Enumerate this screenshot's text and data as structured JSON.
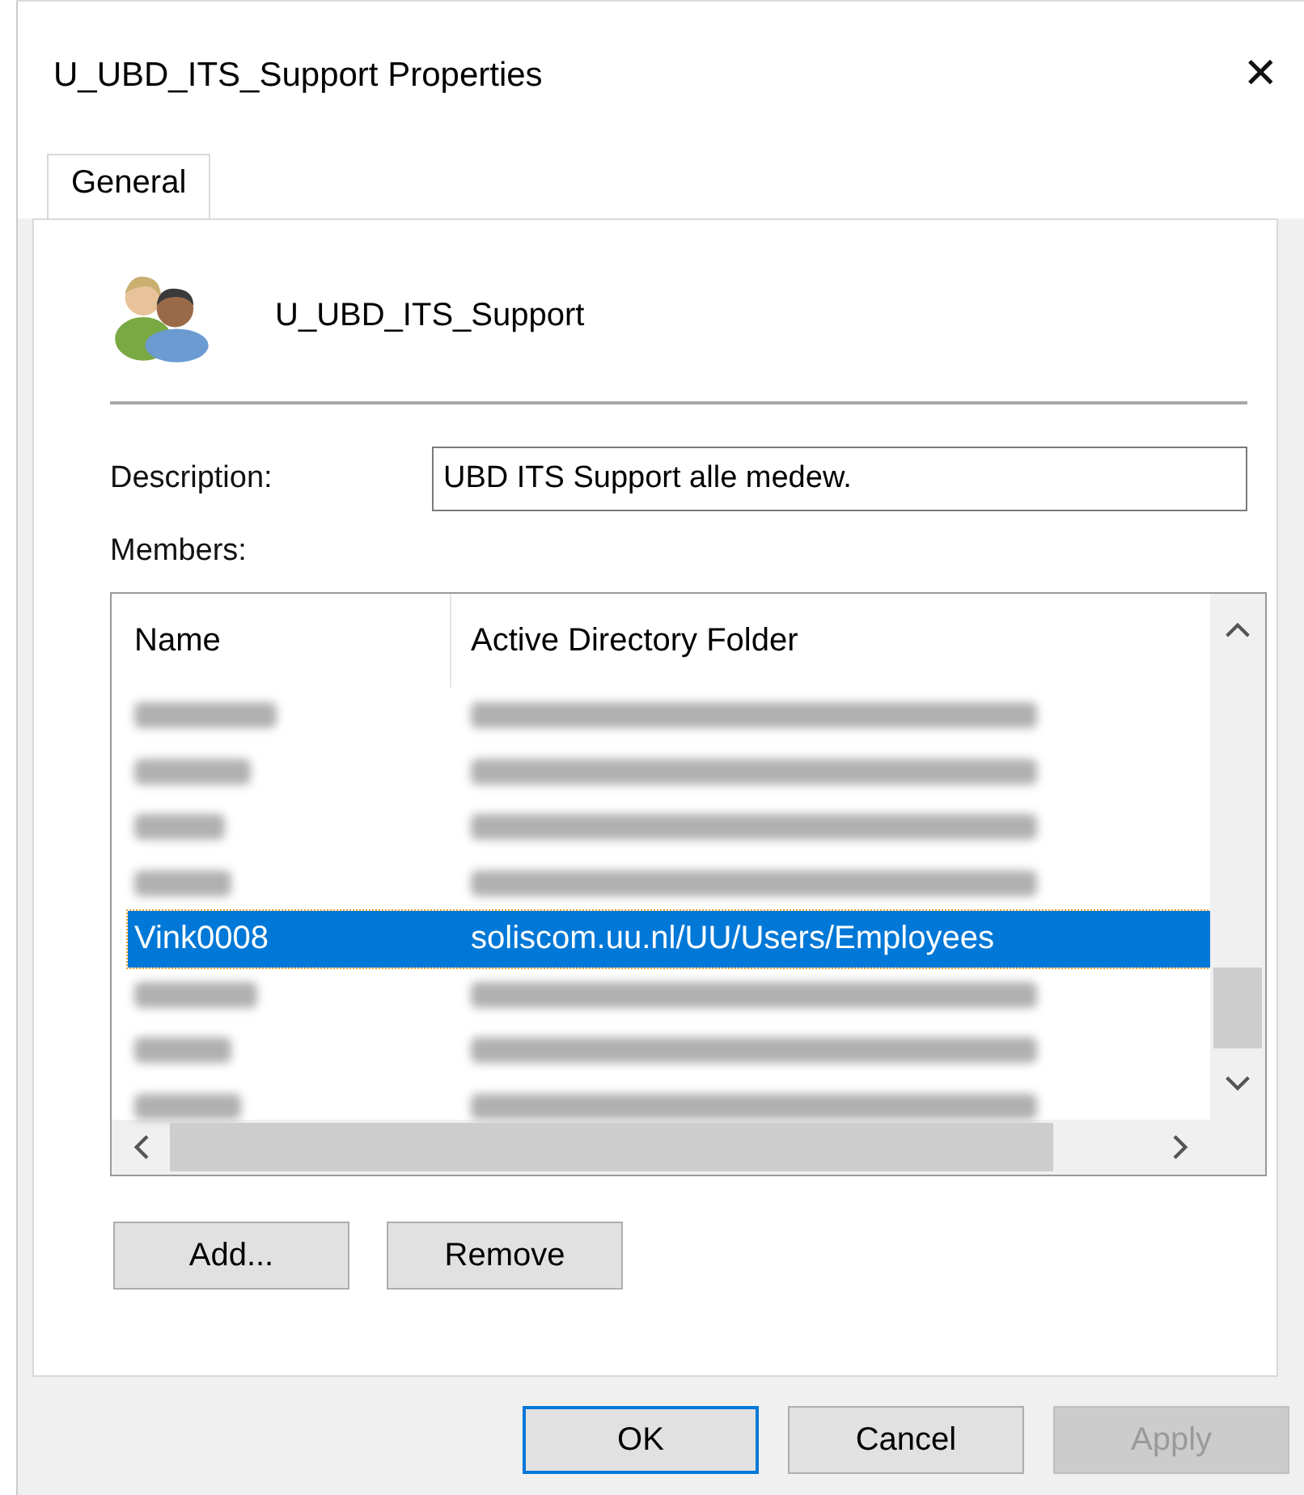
{
  "window": {
    "title": "U_UBD_ITS_Support Properties",
    "close": "✕"
  },
  "tabs": [
    {
      "label": "General",
      "selected": true
    }
  ],
  "group": {
    "name": "U_UBD_ITS_Support"
  },
  "description": {
    "label": "Description:",
    "value": "UBD ITS Support alle medew."
  },
  "members": {
    "label": "Members:",
    "columns": [
      "Name",
      "Active Directory Folder"
    ],
    "rows": [
      {
        "kind": "blurred",
        "selected": false
      },
      {
        "kind": "blurred",
        "selected": false
      },
      {
        "kind": "blurred",
        "selected": false
      },
      {
        "kind": "blurred",
        "selected": false
      },
      {
        "kind": "member",
        "name": "Vink0008",
        "folder": "soliscom.uu.nl/UU/Users/Employees",
        "selected": true
      },
      {
        "kind": "blurred",
        "selected": false
      },
      {
        "kind": "blurred",
        "selected": false
      },
      {
        "kind": "blurred",
        "selected": false
      }
    ]
  },
  "member_buttons": [
    {
      "label": "Add..."
    },
    {
      "label": "Remove"
    }
  ],
  "buttons": [
    {
      "label": "OK",
      "default": true,
      "disabled": false
    },
    {
      "label": "Cancel",
      "default": false,
      "disabled": false
    },
    {
      "label": "Apply",
      "default": false,
      "disabled": true
    }
  ]
}
